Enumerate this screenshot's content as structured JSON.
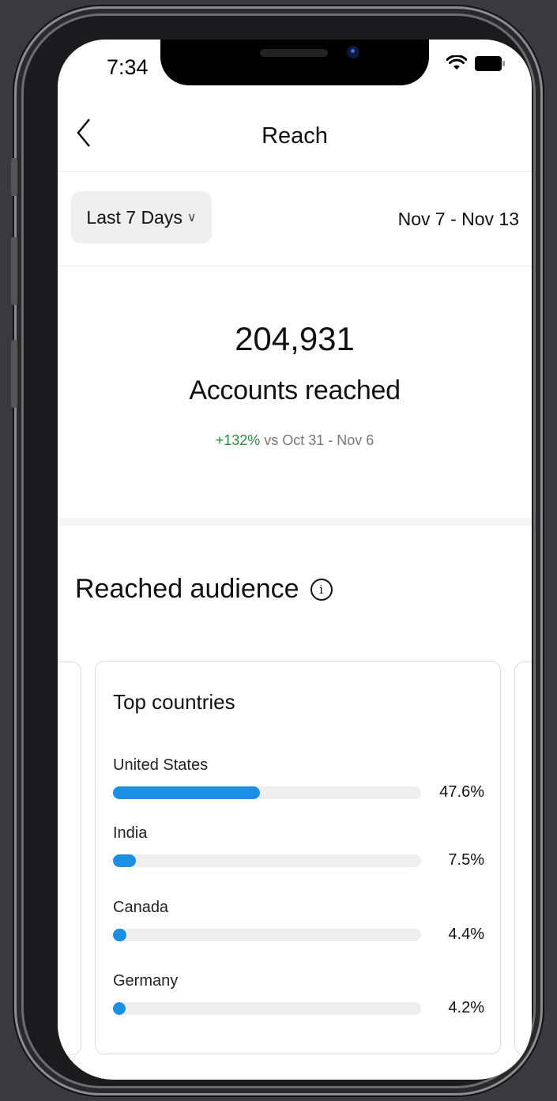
{
  "status": {
    "time": "7:34"
  },
  "nav": {
    "back_icon": "chevron-left-icon",
    "title": "Reach"
  },
  "filter": {
    "range_label": "Last 7 Days",
    "range_chevron": "∨",
    "date_range": "Nov 7 - Nov 13"
  },
  "summary": {
    "count": "204,931",
    "metric": "Accounts reached",
    "change": "+132%",
    "change_suffix": "vs Oct 31 - Nov 6",
    "change_color": "#2e8b3e"
  },
  "audience": {
    "title": "Reached audience",
    "info_icon": "info-icon",
    "card_title": "Top countries",
    "countries": [
      {
        "name": "United States",
        "pct": "47.6%",
        "value": 47.6
      },
      {
        "name": "India",
        "pct": "7.5%",
        "value": 7.5
      },
      {
        "name": "Canada",
        "pct": "4.4%",
        "value": 4.4
      },
      {
        "name": "Germany",
        "pct": "4.2%",
        "value": 4.2
      }
    ],
    "peek_text": "%"
  },
  "colors": {
    "bar_fill": "#1a8fe3",
    "bar_track": "#eeeeee"
  }
}
